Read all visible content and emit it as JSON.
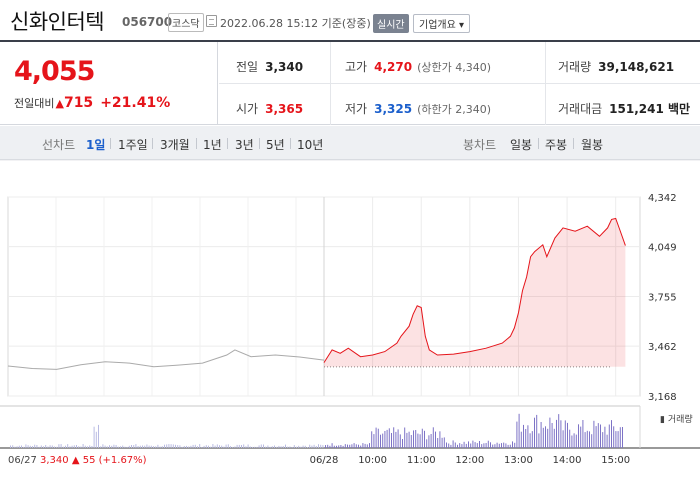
{
  "header": {
    "name": "신화인터텍",
    "code": "056700",
    "market": "코스닥",
    "time": "2022.06.28 15:12 기준(장중)",
    "live": "실시간",
    "info": "기업개요 ▾"
  },
  "summary": {
    "price": "4,055",
    "diff_label": "전일대비",
    "diff_icon": "up-triangle-icon",
    "diff_value": "715",
    "diff_pct": "+21.41%",
    "prev": {
      "label": "전일",
      "value": "3,340"
    },
    "open": {
      "label": "시가",
      "value": "3,365"
    },
    "high": {
      "label": "고가",
      "value": "4,270",
      "sub": "(상한가 4,340)"
    },
    "low": {
      "label": "저가",
      "value": "3,325",
      "sub": "(하한가 2,340)"
    },
    "volume": {
      "label": "거래량",
      "value": "39,148,621"
    },
    "amount": {
      "label": "거래대금",
      "value": "151,241 백만"
    }
  },
  "period_bar": {
    "line_label": "선차트",
    "line_tabs": [
      "1일",
      "1주일",
      "3개월",
      "1년",
      "3년",
      "5년",
      "10년"
    ],
    "active_tab": "1일",
    "candle_label": "봉차트",
    "candle_tabs": [
      "일봉",
      "주봉",
      "월봉"
    ]
  },
  "chart_data": {
    "type": "line",
    "title": "",
    "y_ticks": [
      "4,342",
      "4,049",
      "3,755",
      "3,462",
      "3,168"
    ],
    "ylim": [
      3168,
      4342
    ],
    "x_ticks": [
      "06/28",
      "10:00",
      "11:00",
      "12:00",
      "13:00",
      "14:00",
      "15:00"
    ],
    "prev_close": 3340,
    "volume_label": "거래량",
    "grid": true,
    "series": [
      {
        "name": "06/27",
        "color": "#aaaaaa",
        "points": [
          [
            "09:00",
            3345
          ],
          [
            "09:30",
            3330
          ],
          [
            "10:00",
            3325
          ],
          [
            "10:30",
            3352
          ],
          [
            "11:00",
            3370
          ],
          [
            "11:30",
            3362
          ],
          [
            "12:00",
            3340
          ],
          [
            "12:30",
            3350
          ],
          [
            "13:00",
            3362
          ],
          [
            "13:30",
            3410
          ],
          [
            "13:40",
            3440
          ],
          [
            "14:00",
            3400
          ],
          [
            "14:30",
            3410
          ],
          [
            "15:00",
            3398
          ],
          [
            "15:30",
            3380
          ]
        ]
      },
      {
        "name": "06/28",
        "color": "#e5141a",
        "points": [
          [
            "09:00",
            3365
          ],
          [
            "09:10",
            3440
          ],
          [
            "09:20",
            3420
          ],
          [
            "09:30",
            3450
          ],
          [
            "09:45",
            3400
          ],
          [
            "10:00",
            3410
          ],
          [
            "10:15",
            3430
          ],
          [
            "10:30",
            3480
          ],
          [
            "10:35",
            3520
          ],
          [
            "10:45",
            3580
          ],
          [
            "10:50",
            3650
          ],
          [
            "10:55",
            3700
          ],
          [
            "11:00",
            3690
          ],
          [
            "11:05",
            3520
          ],
          [
            "11:10",
            3440
          ],
          [
            "11:20",
            3410
          ],
          [
            "11:40",
            3415
          ],
          [
            "12:00",
            3430
          ],
          [
            "12:20",
            3450
          ],
          [
            "12:40",
            3480
          ],
          [
            "12:50",
            3520
          ],
          [
            "12:55",
            3570
          ],
          [
            "13:00",
            3660
          ],
          [
            "13:05",
            3790
          ],
          [
            "13:10",
            3870
          ],
          [
            "13:15",
            3990
          ],
          [
            "13:20",
            4020
          ],
          [
            "13:30",
            4060
          ],
          [
            "13:35",
            3990
          ],
          [
            "13:45",
            4100
          ],
          [
            "13:55",
            4160
          ],
          [
            "14:10",
            4140
          ],
          [
            "14:25",
            4170
          ],
          [
            "14:40",
            4110
          ],
          [
            "14:50",
            4160
          ],
          [
            "14:55",
            4210
          ],
          [
            "15:00",
            4215
          ],
          [
            "15:05",
            4150
          ],
          [
            "15:12",
            4055
          ]
        ]
      }
    ]
  },
  "footer": {
    "date": "06/27",
    "price": "3,340",
    "change": "▲ 55 (+1.67%)"
  }
}
